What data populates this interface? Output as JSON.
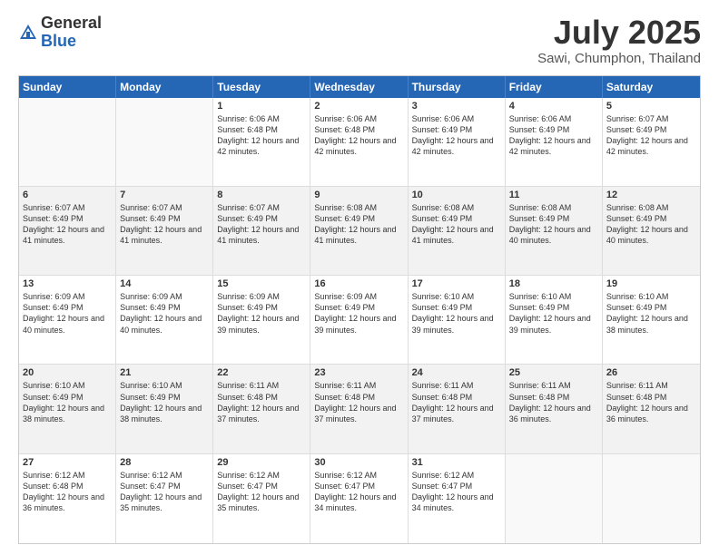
{
  "header": {
    "logo_general": "General",
    "logo_blue": "Blue",
    "month": "July 2025",
    "location": "Sawi, Chumphon, Thailand"
  },
  "weekdays": [
    "Sunday",
    "Monday",
    "Tuesday",
    "Wednesday",
    "Thursday",
    "Friday",
    "Saturday"
  ],
  "weeks": [
    [
      {
        "day": "",
        "info": "",
        "empty": true
      },
      {
        "day": "",
        "info": "",
        "empty": true
      },
      {
        "day": "1",
        "info": "Sunrise: 6:06 AM\nSunset: 6:48 PM\nDaylight: 12 hours and 42 minutes."
      },
      {
        "day": "2",
        "info": "Sunrise: 6:06 AM\nSunset: 6:48 PM\nDaylight: 12 hours and 42 minutes."
      },
      {
        "day": "3",
        "info": "Sunrise: 6:06 AM\nSunset: 6:49 PM\nDaylight: 12 hours and 42 minutes."
      },
      {
        "day": "4",
        "info": "Sunrise: 6:06 AM\nSunset: 6:49 PM\nDaylight: 12 hours and 42 minutes."
      },
      {
        "day": "5",
        "info": "Sunrise: 6:07 AM\nSunset: 6:49 PM\nDaylight: 12 hours and 42 minutes."
      }
    ],
    [
      {
        "day": "6",
        "info": "Sunrise: 6:07 AM\nSunset: 6:49 PM\nDaylight: 12 hours and 41 minutes.",
        "shaded": true
      },
      {
        "day": "7",
        "info": "Sunrise: 6:07 AM\nSunset: 6:49 PM\nDaylight: 12 hours and 41 minutes.",
        "shaded": true
      },
      {
        "day": "8",
        "info": "Sunrise: 6:07 AM\nSunset: 6:49 PM\nDaylight: 12 hours and 41 minutes.",
        "shaded": true
      },
      {
        "day": "9",
        "info": "Sunrise: 6:08 AM\nSunset: 6:49 PM\nDaylight: 12 hours and 41 minutes.",
        "shaded": true
      },
      {
        "day": "10",
        "info": "Sunrise: 6:08 AM\nSunset: 6:49 PM\nDaylight: 12 hours and 41 minutes.",
        "shaded": true
      },
      {
        "day": "11",
        "info": "Sunrise: 6:08 AM\nSunset: 6:49 PM\nDaylight: 12 hours and 40 minutes.",
        "shaded": true
      },
      {
        "day": "12",
        "info": "Sunrise: 6:08 AM\nSunset: 6:49 PM\nDaylight: 12 hours and 40 minutes.",
        "shaded": true
      }
    ],
    [
      {
        "day": "13",
        "info": "Sunrise: 6:09 AM\nSunset: 6:49 PM\nDaylight: 12 hours and 40 minutes."
      },
      {
        "day": "14",
        "info": "Sunrise: 6:09 AM\nSunset: 6:49 PM\nDaylight: 12 hours and 40 minutes."
      },
      {
        "day": "15",
        "info": "Sunrise: 6:09 AM\nSunset: 6:49 PM\nDaylight: 12 hours and 39 minutes."
      },
      {
        "day": "16",
        "info": "Sunrise: 6:09 AM\nSunset: 6:49 PM\nDaylight: 12 hours and 39 minutes."
      },
      {
        "day": "17",
        "info": "Sunrise: 6:10 AM\nSunset: 6:49 PM\nDaylight: 12 hours and 39 minutes."
      },
      {
        "day": "18",
        "info": "Sunrise: 6:10 AM\nSunset: 6:49 PM\nDaylight: 12 hours and 39 minutes."
      },
      {
        "day": "19",
        "info": "Sunrise: 6:10 AM\nSunset: 6:49 PM\nDaylight: 12 hours and 38 minutes."
      }
    ],
    [
      {
        "day": "20",
        "info": "Sunrise: 6:10 AM\nSunset: 6:49 PM\nDaylight: 12 hours and 38 minutes.",
        "shaded": true
      },
      {
        "day": "21",
        "info": "Sunrise: 6:10 AM\nSunset: 6:49 PM\nDaylight: 12 hours and 38 minutes.",
        "shaded": true
      },
      {
        "day": "22",
        "info": "Sunrise: 6:11 AM\nSunset: 6:48 PM\nDaylight: 12 hours and 37 minutes.",
        "shaded": true
      },
      {
        "day": "23",
        "info": "Sunrise: 6:11 AM\nSunset: 6:48 PM\nDaylight: 12 hours and 37 minutes.",
        "shaded": true
      },
      {
        "day": "24",
        "info": "Sunrise: 6:11 AM\nSunset: 6:48 PM\nDaylight: 12 hours and 37 minutes.",
        "shaded": true
      },
      {
        "day": "25",
        "info": "Sunrise: 6:11 AM\nSunset: 6:48 PM\nDaylight: 12 hours and 36 minutes.",
        "shaded": true
      },
      {
        "day": "26",
        "info": "Sunrise: 6:11 AM\nSunset: 6:48 PM\nDaylight: 12 hours and 36 minutes.",
        "shaded": true
      }
    ],
    [
      {
        "day": "27",
        "info": "Sunrise: 6:12 AM\nSunset: 6:48 PM\nDaylight: 12 hours and 36 minutes."
      },
      {
        "day": "28",
        "info": "Sunrise: 6:12 AM\nSunset: 6:47 PM\nDaylight: 12 hours and 35 minutes."
      },
      {
        "day": "29",
        "info": "Sunrise: 6:12 AM\nSunset: 6:47 PM\nDaylight: 12 hours and 35 minutes."
      },
      {
        "day": "30",
        "info": "Sunrise: 6:12 AM\nSunset: 6:47 PM\nDaylight: 12 hours and 34 minutes."
      },
      {
        "day": "31",
        "info": "Sunrise: 6:12 AM\nSunset: 6:47 PM\nDaylight: 12 hours and 34 minutes."
      },
      {
        "day": "",
        "info": "",
        "empty": true
      },
      {
        "day": "",
        "info": "",
        "empty": true
      }
    ]
  ]
}
